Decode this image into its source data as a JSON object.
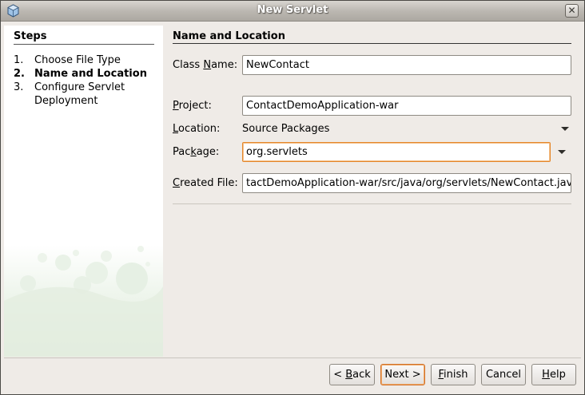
{
  "window": {
    "title": "New Servlet",
    "close_glyph": "✕"
  },
  "steps": {
    "title": "Steps",
    "items": [
      {
        "num": "1.",
        "label": "Choose File Type"
      },
      {
        "num": "2.",
        "label": "Name and Location"
      },
      {
        "num": "3.",
        "label": "Configure Servlet"
      },
      {
        "num": "",
        "label": "Deployment"
      }
    ]
  },
  "main": {
    "section_title": "Name and Location",
    "class_name": {
      "label_pre": "Class ",
      "label_u": "N",
      "label_post": "ame:",
      "value": "NewContact"
    },
    "project": {
      "label_pre": "",
      "label_u": "P",
      "label_post": "roject:",
      "value": "ContactDemoApplication-war"
    },
    "location": {
      "label_pre": "",
      "label_u": "L",
      "label_post": "ocation:",
      "value": "Source Packages"
    },
    "package": {
      "label_pre": "Pac",
      "label_u": "k",
      "label_post": "age:",
      "value": "org.servlets"
    },
    "created_file": {
      "label_pre": "",
      "label_u": "C",
      "label_post": "reated File:",
      "value": "tactDemoApplication-war/src/java/org/servlets/NewContact.java"
    }
  },
  "buttons": {
    "back": {
      "pre": "< ",
      "u": "B",
      "post": "ack"
    },
    "next": {
      "label": "Next >"
    },
    "finish": {
      "pre": "",
      "u": "F",
      "post": "inish"
    },
    "cancel": {
      "label": "Cancel"
    },
    "help": {
      "pre": "",
      "u": "H",
      "post": "elp"
    }
  },
  "colors": {
    "focus_accent": "#e5872a",
    "bubble": "#e6f0e4"
  }
}
